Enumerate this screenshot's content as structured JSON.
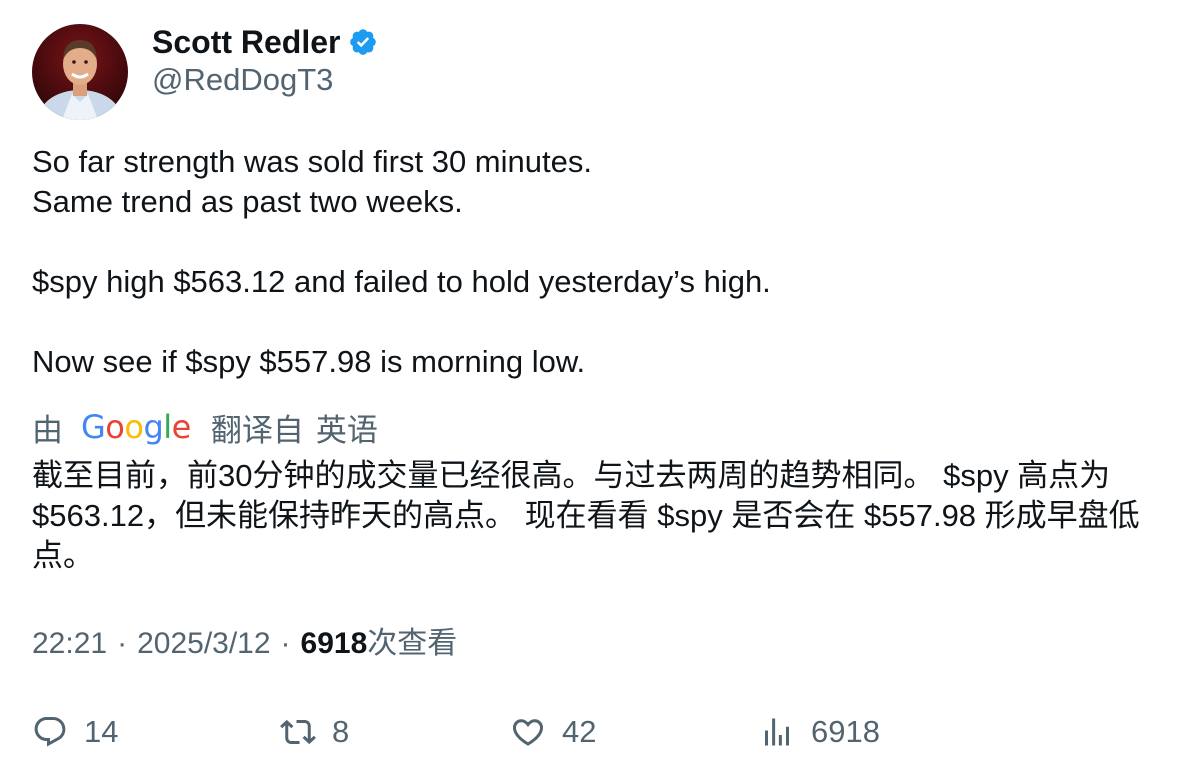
{
  "author": {
    "display_name": "Scott Redler",
    "handle": "@RedDogT3",
    "verified": true,
    "avatar": "profile-photo"
  },
  "tweet": {
    "lines": [
      "So far strength was sold first 30 minutes.",
      "Same trend as past two weeks.",
      "",
      "$spy high $563.12 and failed to hold yesterday’s high.",
      "",
      "Now see if $spy $557.98 is morning low."
    ]
  },
  "translation": {
    "by_label": "由",
    "provider": "Google",
    "from_label": "翻译自",
    "language": "英语",
    "text": "截至目前，前30分钟的成交量已经很高。与过去两周的趋势相同。 $spy 高点为 $563.12，但未能保持昨天的高点。 现在看看 $spy 是否会在 $557.98 形成早盘低点。"
  },
  "meta": {
    "time": "22:21",
    "separator": "·",
    "date": "2025/3/12",
    "views_count": "6918",
    "views_label": "次查看"
  },
  "actions": {
    "reply_count": "14",
    "retweet_count": "8",
    "like_count": "42",
    "views_count": "6918"
  },
  "colors": {
    "text_primary": "#0f1419",
    "text_secondary": "#536471",
    "verified_blue": "#1d9bf0",
    "google_blue": "#4285F4",
    "google_red": "#EA4335",
    "google_yellow": "#FBBC05",
    "google_green": "#34A853"
  }
}
